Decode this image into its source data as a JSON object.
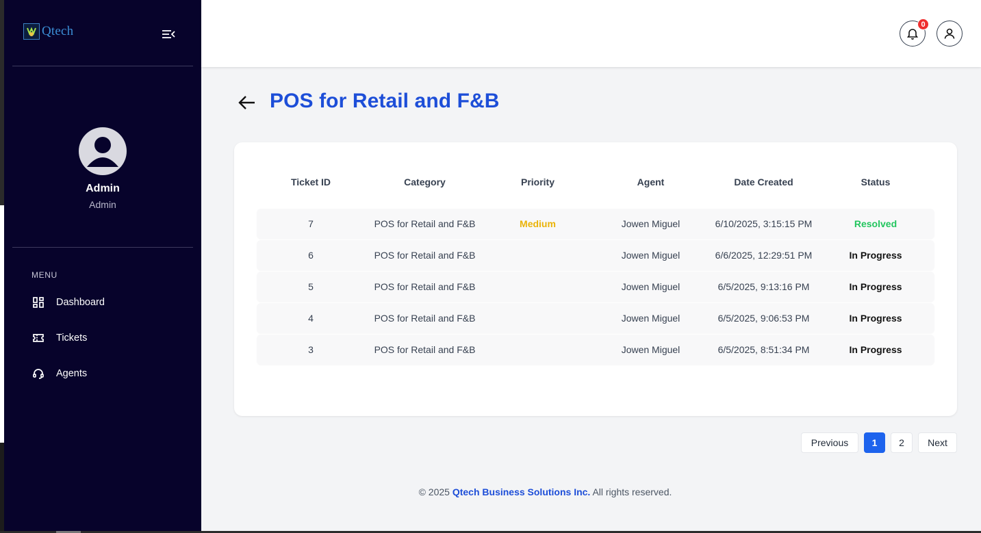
{
  "brand": {
    "name": "Qtech"
  },
  "sidebar": {
    "profile": {
      "name": "Admin",
      "role": "Admin"
    },
    "menu_label": "MENU",
    "items": [
      {
        "label": "Dashboard",
        "icon": "dashboard-icon"
      },
      {
        "label": "Tickets",
        "icon": "ticket-icon"
      },
      {
        "label": "Agents",
        "icon": "headset-icon"
      }
    ]
  },
  "topbar": {
    "notification_count": "0"
  },
  "page": {
    "title": "POS for Retail and F&B"
  },
  "table": {
    "headers": [
      "Ticket ID",
      "Category",
      "Priority",
      "Agent",
      "Date Created",
      "Status"
    ],
    "rows": [
      {
        "id": "7",
        "category": "POS for Retail and F&B",
        "priority": "Medium",
        "agent": "Jowen Miguel",
        "date": "6/10/2025, 3:15:15 PM",
        "status": "Resolved"
      },
      {
        "id": "6",
        "category": "POS for Retail and F&B",
        "priority": "",
        "agent": "Jowen Miguel",
        "date": "6/6/2025, 12:29:51 PM",
        "status": "In Progress"
      },
      {
        "id": "5",
        "category": "POS for Retail and F&B",
        "priority": "",
        "agent": "Jowen Miguel",
        "date": "6/5/2025, 9:13:16 PM",
        "status": "In Progress"
      },
      {
        "id": "4",
        "category": "POS for Retail and F&B",
        "priority": "",
        "agent": "Jowen Miguel",
        "date": "6/5/2025, 9:06:53 PM",
        "status": "In Progress"
      },
      {
        "id": "3",
        "category": "POS for Retail and F&B",
        "priority": "",
        "agent": "Jowen Miguel",
        "date": "6/5/2025, 8:51:34 PM",
        "status": "In Progress"
      }
    ]
  },
  "pagination": {
    "previous": "Previous",
    "pages": [
      "1",
      "2"
    ],
    "current": "1",
    "next": "Next"
  },
  "footer": {
    "prefix": "© 2025 ",
    "company": "Qtech Business Solutions Inc.",
    "suffix": " All rights reserved."
  },
  "colors": {
    "sidebar_bg": "#07032b",
    "accent": "#1d4ed8",
    "active_page": "#1d63ed",
    "medium": "#eab308",
    "resolved": "#22c55e",
    "badge": "#ef2d2d"
  }
}
